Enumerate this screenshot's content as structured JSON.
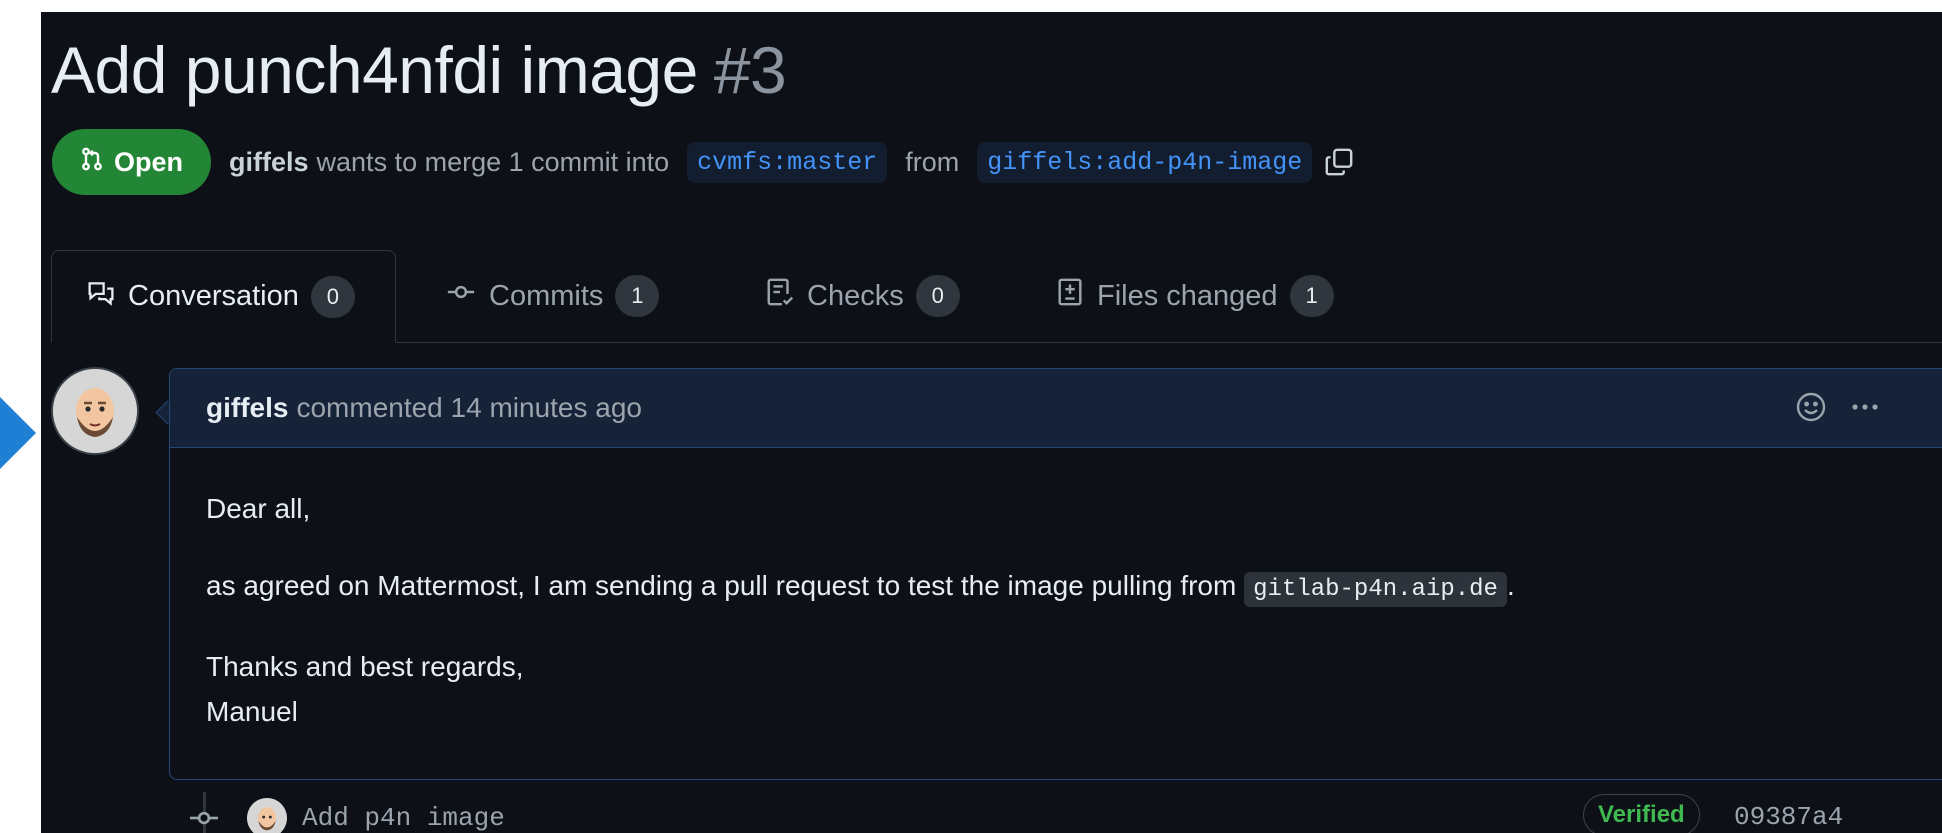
{
  "pull_request": {
    "title": "Add punch4nfdi image",
    "number": "#3",
    "state": "Open",
    "author": "giffels",
    "merge_text": "wants to merge 1 commit into",
    "base_branch": "cvmfs:master",
    "from_text": "from",
    "head_branch": "giffels:add-p4n-image"
  },
  "tabs": [
    {
      "label": "Conversation",
      "count": "0"
    },
    {
      "label": "Commits",
      "count": "1"
    },
    {
      "label": "Checks",
      "count": "0"
    },
    {
      "label": "Files changed",
      "count": "1"
    }
  ],
  "comment": {
    "author": "giffels",
    "time_text": "commented 14 minutes ago",
    "line1": "Dear all,",
    "line2_prefix": "as agreed on Mattermost, I am sending a pull request to test the image pulling from",
    "line2_code": "gitlab-p4n.aip.de",
    "line2_suffix": ".",
    "line3": "Thanks and best regards,",
    "line4": "Manuel"
  },
  "commit": {
    "message": "Add p4n image",
    "verified_label": "Verified",
    "sha": "09387a4"
  },
  "colors": {
    "background": "#0d1117",
    "open_badge": "#238636",
    "link": "#4493f8",
    "verified": "#3fb950",
    "pointer_arrow": "#1f7fd4"
  },
  "icons": [
    "pull-request-icon",
    "copy-icon",
    "comment-discussion-icon",
    "commit-icon",
    "checklist-icon",
    "file-diff-icon",
    "smiley-icon",
    "kebab-horizontal-icon"
  ]
}
